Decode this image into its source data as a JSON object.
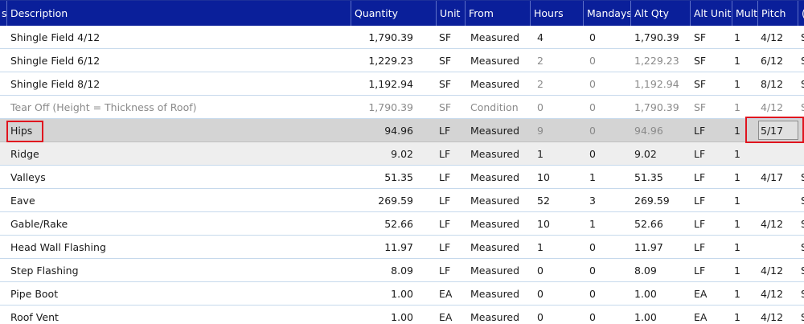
{
  "columns": {
    "c0": "s",
    "description": "Description",
    "quantity": "Quantity",
    "unit": "Unit",
    "from": "From",
    "hours": "Hours",
    "mandays": "Mandays",
    "alt_qty": "Alt Qty",
    "alt_unit": "Alt Unit",
    "mult": "Mult",
    "pitch": "Pitch",
    "more": "("
  },
  "rows": [
    {
      "description": "Shingle Field 4/12",
      "quantity": "1,790.39",
      "unit": "SF",
      "from": "Measured",
      "hours": "4",
      "mandays": "0",
      "alt_qty": "1,790.39",
      "alt_unit": "SF",
      "mult": "1",
      "pitch": "4/12",
      "extra": "S"
    },
    {
      "description": "Shingle Field 6/12",
      "quantity": "1,229.23",
      "unit": "SF",
      "from": "Measured",
      "hours": "2",
      "mandays": "0",
      "alt_qty": "1,229.23",
      "alt_unit": "SF",
      "mult": "1",
      "pitch": "6/12",
      "extra": "S"
    },
    {
      "description": "Shingle Field 8/12",
      "quantity": "1,192.94",
      "unit": "SF",
      "from": "Measured",
      "hours": "2",
      "mandays": "0",
      "alt_qty": "1,192.94",
      "alt_unit": "SF",
      "mult": "1",
      "pitch": "8/12",
      "extra": "S"
    },
    {
      "description": "Tear Off (Height = Thickness of Roof)",
      "quantity": "1,790.39",
      "unit": "SF",
      "from": "Condition",
      "hours": "0",
      "mandays": "0",
      "alt_qty": "1,790.39",
      "alt_unit": "SF",
      "mult": "1",
      "pitch": "4/12",
      "extra": "S"
    },
    {
      "description": "Hips",
      "quantity": "94.96",
      "unit": "LF",
      "from": "Measured",
      "hours": "9",
      "mandays": "0",
      "alt_qty": "94.96",
      "alt_unit": "LF",
      "mult": "1",
      "pitch": "5/17",
      "extra": ""
    },
    {
      "description": "Ridge",
      "quantity": "9.02",
      "unit": "LF",
      "from": "Measured",
      "hours": "1",
      "mandays": "0",
      "alt_qty": "9.02",
      "alt_unit": "LF",
      "mult": "1",
      "pitch": "",
      "extra": ""
    },
    {
      "description": "Valleys",
      "quantity": "51.35",
      "unit": "LF",
      "from": "Measured",
      "hours": "10",
      "mandays": "1",
      "alt_qty": "51.35",
      "alt_unit": "LF",
      "mult": "1",
      "pitch": "4/17",
      "extra": "S"
    },
    {
      "description": "Eave",
      "quantity": "269.59",
      "unit": "LF",
      "from": "Measured",
      "hours": "52",
      "mandays": "3",
      "alt_qty": "269.59",
      "alt_unit": "LF",
      "mult": "1",
      "pitch": "",
      "extra": "S"
    },
    {
      "description": "Gable/Rake",
      "quantity": "52.66",
      "unit": "LF",
      "from": "Measured",
      "hours": "10",
      "mandays": "1",
      "alt_qty": "52.66",
      "alt_unit": "LF",
      "mult": "1",
      "pitch": "4/12",
      "extra": "S"
    },
    {
      "description": "Head Wall Flashing",
      "quantity": "11.97",
      "unit": "LF",
      "from": "Measured",
      "hours": "1",
      "mandays": "0",
      "alt_qty": "11.97",
      "alt_unit": "LF",
      "mult": "1",
      "pitch": "",
      "extra": "S"
    },
    {
      "description": "Step Flashing",
      "quantity": "8.09",
      "unit": "LF",
      "from": "Measured",
      "hours": "0",
      "mandays": "0",
      "alt_qty": "8.09",
      "alt_unit": "LF",
      "mult": "1",
      "pitch": "4/12",
      "extra": "S"
    },
    {
      "description": "Pipe Boot",
      "quantity": "1.00",
      "unit": "EA",
      "from": "Measured",
      "hours": "0",
      "mandays": "0",
      "alt_qty": "1.00",
      "alt_unit": "EA",
      "mult": "1",
      "pitch": "4/12",
      "extra": "S"
    },
    {
      "description": "Roof Vent",
      "quantity": "1.00",
      "unit": "EA",
      "from": "Measured",
      "hours": "0",
      "mandays": "0",
      "alt_qty": "1.00",
      "alt_unit": "EA",
      "mult": "1",
      "pitch": "4/12",
      "extra": "S"
    }
  ],
  "colors": {
    "header_bg": "#0a1f9a",
    "highlight": "#e0141e",
    "selected_row": "#d4d4d4",
    "muted_text": "#8a8a8a"
  }
}
